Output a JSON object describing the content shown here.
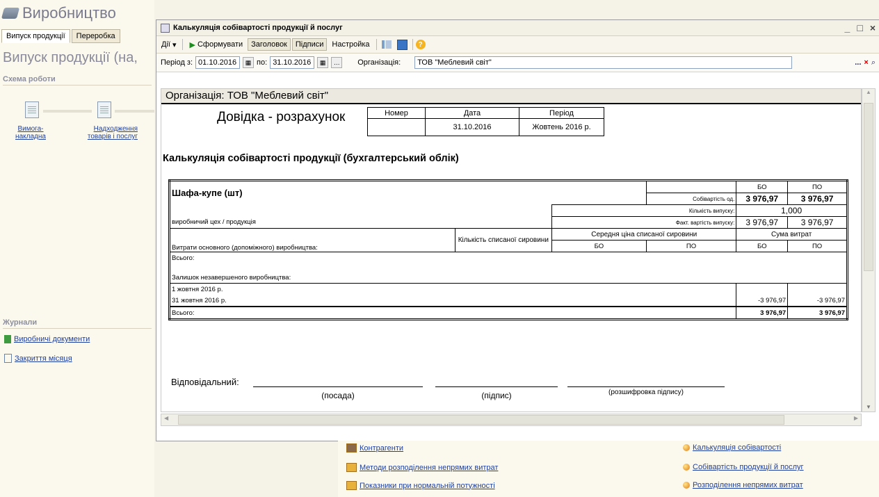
{
  "app": {
    "title": "Виробництво",
    "tabs": [
      "Випуск продукції",
      "Переробка"
    ],
    "section_title": "Випуск продукції (на,",
    "scheme_label": "Схема роботи",
    "scheme_items": [
      {
        "label": "Вимога-накладна"
      },
      {
        "label": "Надходження товарів і послуг"
      }
    ],
    "journals_label": "Журнали",
    "journals": [
      "Виробничі документи",
      "Закриття місяця"
    ]
  },
  "window": {
    "title": "Калькуляція собівартості продукції й послуг",
    "toolbar": {
      "actions": "Дії",
      "generate": "Сформувати",
      "header": "Заголовок",
      "signatures": "Підписи",
      "settings": "Настройка"
    },
    "params": {
      "period_label": "Період з:",
      "date_from": "01.10.2016",
      "to_label": "по:",
      "date_to": "31.10.2016",
      "org_label": "Організація:",
      "org_value": "ТОВ \"Меблевий світ\"",
      "dots": "..."
    }
  },
  "report": {
    "org_line": "Організація: ТОВ \"Меблевий світ\"",
    "doc_title": "Довідка - розрахунок",
    "hdr": {
      "number_h": "Номер",
      "date_h": "Дата",
      "period_h": "Період",
      "number": "",
      "date": "31.10.2016",
      "period": "Жовтень 2016 р."
    },
    "calc_title": "Калькуляція собівартості продукції (бухгалтерський облік)",
    "product": "Шафа-купе (шт)",
    "bo": "БО",
    "po": "ПО",
    "unit_cost_l": "Собівартість од.",
    "unit_cost_bo": "3 976,97",
    "unit_cost_po": "3 976,97",
    "qty_l": "Кількість випуску:",
    "qty": "1,000",
    "fact_l": "Факт. вартість випуску:",
    "fact_bo": "3 976,97",
    "fact_po": "3 976,97",
    "workshop": "виробничий цех / продукція",
    "col_costs": "Витрати основного (допоміжного) виробництва:",
    "col_qty": "Кількість списаної сировини",
    "col_avg": "Середня ціна списаної сировини",
    "col_sum": "Сума витрат",
    "total1": "Всього:",
    "wip": "Залишок незавершеного виробництва:",
    "wip_d1": "1 жовтня 2016 р.",
    "wip_d2": "31 жовтня 2016 р.",
    "wip_d2_bo": "-3 976,97",
    "wip_d2_po": "-3 976,97",
    "total2": "Всього:",
    "total2_bo": "3 976,97",
    "total2_po": "3 976,97",
    "resp": "Відповідальний:",
    "pos": "(посада)",
    "sign": "(підпис)",
    "decode": "(розшифровка підпису)"
  },
  "bottom_links": {
    "left": [
      "Контрагенти",
      "Методи розподілення непрямих витрат",
      "Показники при нормальній потужності"
    ],
    "right": [
      "Калькуляція собівартості",
      "Собівартість продукції й послуг",
      "Розподілення непрямих витрат"
    ]
  }
}
